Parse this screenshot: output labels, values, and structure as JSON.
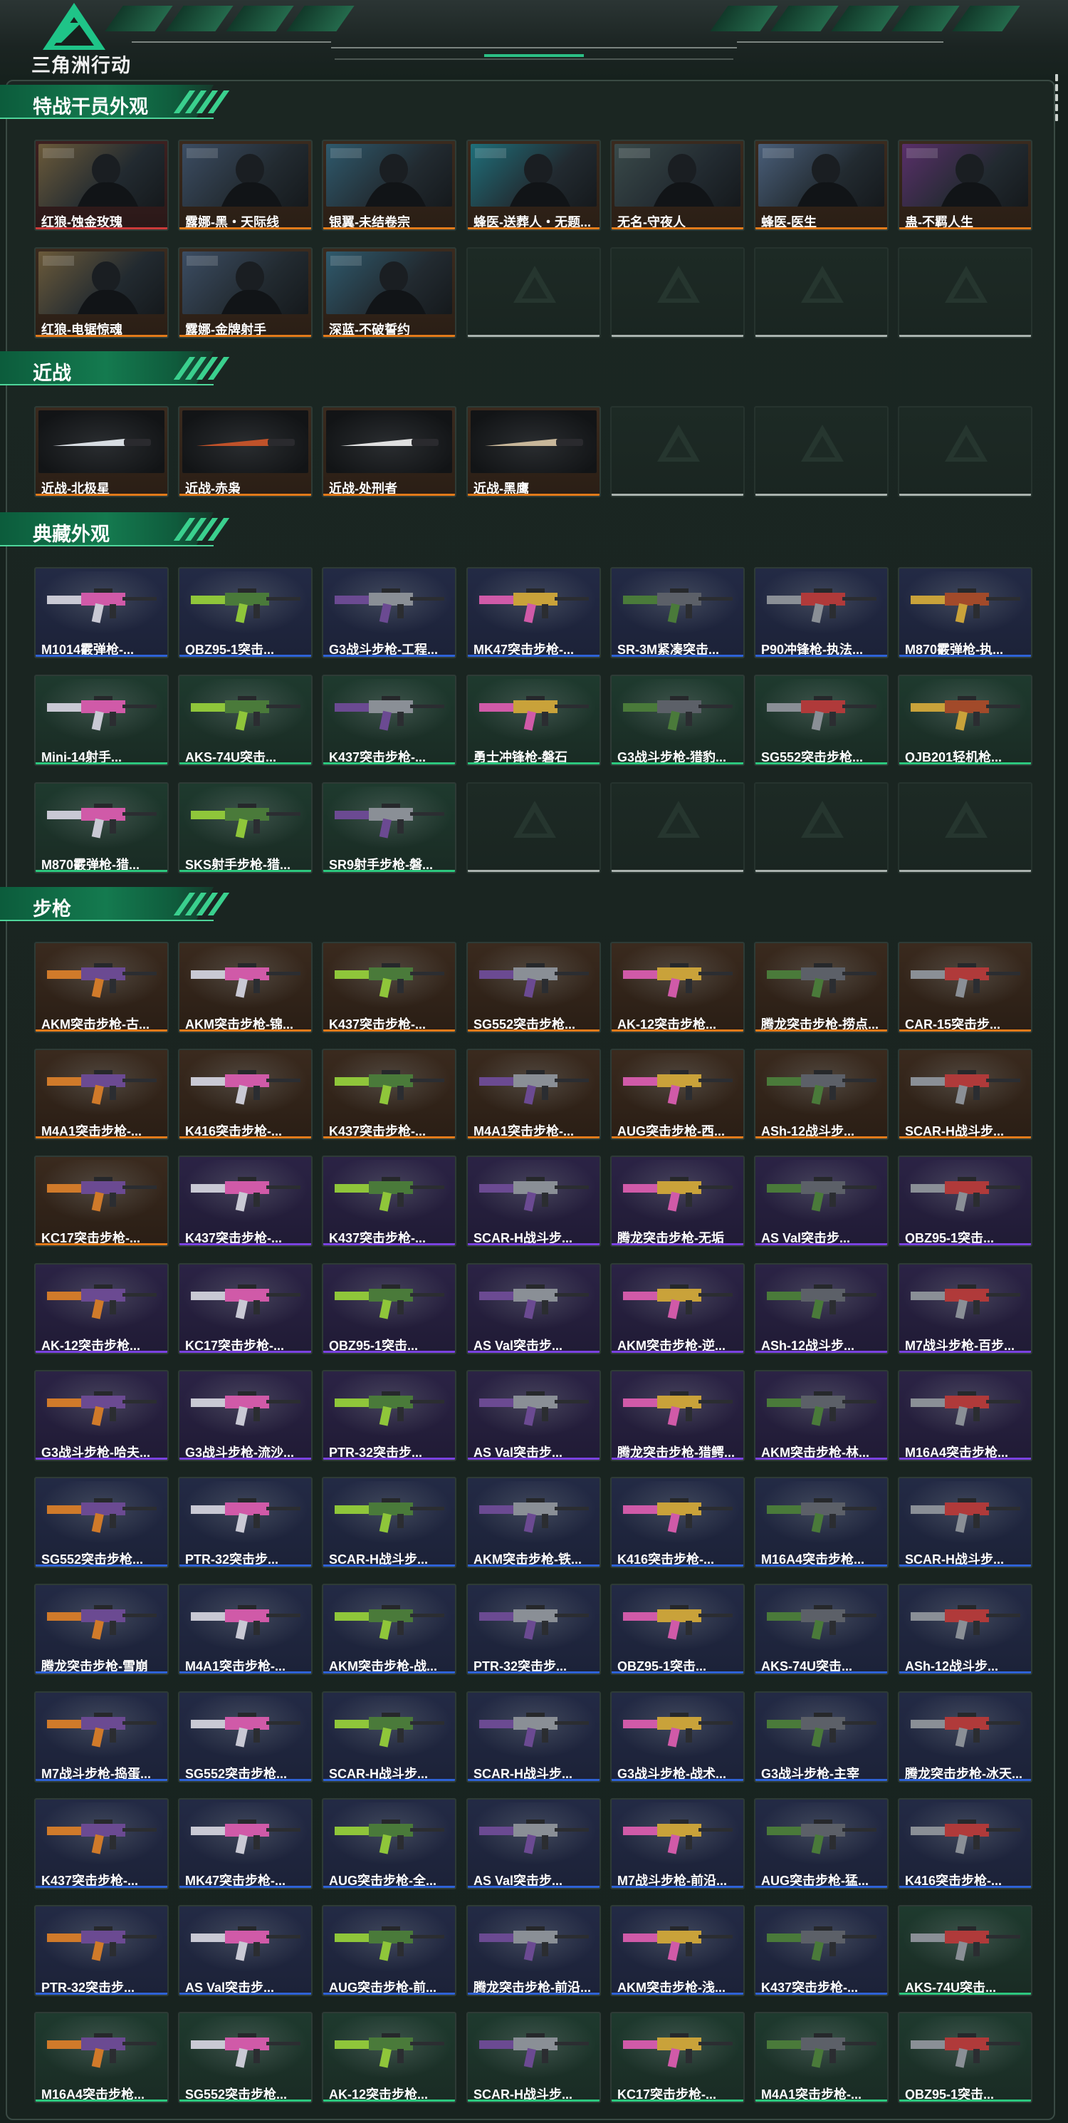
{
  "brand": {
    "logo_text": "三角洲行动"
  },
  "colors": {
    "orange": "#e27a1a",
    "blue": "#2e62d6",
    "green": "#2cc77e",
    "purple": "#7a42e0",
    "red": "#cc3a3a"
  },
  "sections": [
    {
      "title": "特战干员外观",
      "kind": "agent",
      "rows": [
        [
          {
            "label": "红狼-蚀金玫瑰",
            "rarity": "red"
          },
          {
            "label": "露娜-黑・天际线",
            "rarity": "orange"
          },
          {
            "label": "银翼-未结卷宗",
            "rarity": "orange"
          },
          {
            "label": "蜂医-送葬人・无题...",
            "rarity": "orange"
          },
          {
            "label": "无名-守夜人",
            "rarity": "orange"
          },
          {
            "label": "蜂医-医生",
            "rarity": "orange"
          },
          {
            "label": "蛊-不羁人生",
            "rarity": "orange"
          }
        ],
        [
          {
            "label": "红狼-电锯惊魂",
            "rarity": "orange"
          },
          {
            "label": "露娜-金牌射手",
            "rarity": "orange"
          },
          {
            "label": "深蓝-不破誓约",
            "rarity": "orange"
          },
          {
            "label": "",
            "rarity": "empty"
          },
          {
            "label": "",
            "rarity": "empty"
          },
          {
            "label": "",
            "rarity": "empty"
          },
          {
            "label": "",
            "rarity": "empty"
          }
        ]
      ]
    },
    {
      "title": "近战",
      "kind": "knife",
      "rows": [
        [
          {
            "label": "近战-北极星",
            "rarity": "orange"
          },
          {
            "label": "近战-赤枭",
            "rarity": "orange"
          },
          {
            "label": "近战-处刑者",
            "rarity": "orange"
          },
          {
            "label": "近战-黑鹰",
            "rarity": "orange"
          },
          {
            "label": "",
            "rarity": "empty"
          },
          {
            "label": "",
            "rarity": "empty"
          },
          {
            "label": "",
            "rarity": "empty"
          }
        ]
      ]
    },
    {
      "title": "典藏外观",
      "kind": "gun",
      "rows": [
        [
          {
            "label": "M1014霰弹枪-...",
            "rarity": "blue"
          },
          {
            "label": "QBZ95-1突击...",
            "rarity": "blue"
          },
          {
            "label": "G3战斗步枪-工程...",
            "rarity": "blue"
          },
          {
            "label": "MK47突击步枪-...",
            "rarity": "blue"
          },
          {
            "label": "SR-3M紧凑突击...",
            "rarity": "blue"
          },
          {
            "label": "P90冲锋枪-执法...",
            "rarity": "blue"
          },
          {
            "label": "M870霰弹枪-执...",
            "rarity": "blue"
          }
        ],
        [
          {
            "label": "Mini-14射手...",
            "rarity": "green"
          },
          {
            "label": "AKS-74U突击...",
            "rarity": "green"
          },
          {
            "label": "K437突击步枪-...",
            "rarity": "green"
          },
          {
            "label": "勇士冲锋枪-磐石",
            "rarity": "green"
          },
          {
            "label": "G3战斗步枪-猎豹...",
            "rarity": "green"
          },
          {
            "label": "SG552突击步枪...",
            "rarity": "green"
          },
          {
            "label": "QJB201轻机枪...",
            "rarity": "green"
          }
        ],
        [
          {
            "label": "M870霰弹枪-猎...",
            "rarity": "green"
          },
          {
            "label": "SKS射手步枪-猎...",
            "rarity": "green"
          },
          {
            "label": "SR9射手步枪-磐...",
            "rarity": "green"
          },
          {
            "label": "",
            "rarity": "empty"
          },
          {
            "label": "",
            "rarity": "empty"
          },
          {
            "label": "",
            "rarity": "empty"
          },
          {
            "label": "",
            "rarity": "empty"
          }
        ]
      ]
    },
    {
      "title": "步枪",
      "kind": "gun",
      "rows": [
        [
          {
            "label": "AKM突击步枪-古...",
            "rarity": "orange"
          },
          {
            "label": "AKM突击步枪-锦...",
            "rarity": "orange"
          },
          {
            "label": "K437突击步枪-...",
            "rarity": "orange"
          },
          {
            "label": "SG552突击步枪...",
            "rarity": "orange"
          },
          {
            "label": "AK-12突击步枪...",
            "rarity": "orange"
          },
          {
            "label": "腾龙突击步枪-捞点...",
            "rarity": "orange"
          },
          {
            "label": "CAR-15突击步...",
            "rarity": "orange"
          }
        ],
        [
          {
            "label": "M4A1突击步枪-...",
            "rarity": "orange"
          },
          {
            "label": "K416突击步枪-...",
            "rarity": "orange"
          },
          {
            "label": "K437突击步枪-...",
            "rarity": "orange"
          },
          {
            "label": "M4A1突击步枪-...",
            "rarity": "orange"
          },
          {
            "label": "AUG突击步枪-西...",
            "rarity": "orange"
          },
          {
            "label": "ASh-12战斗步...",
            "rarity": "orange"
          },
          {
            "label": "SCAR-H战斗步...",
            "rarity": "orange"
          }
        ],
        [
          {
            "label": "KC17突击步枪-...",
            "rarity": "orange"
          },
          {
            "label": "K437突击步枪-...",
            "rarity": "purple"
          },
          {
            "label": "K437突击步枪-...",
            "rarity": "purple"
          },
          {
            "label": "SCAR-H战斗步...",
            "rarity": "purple"
          },
          {
            "label": "腾龙突击步枪-无垢",
            "rarity": "purple"
          },
          {
            "label": "AS Val突击步...",
            "rarity": "purple"
          },
          {
            "label": "QBZ95-1突击...",
            "rarity": "purple"
          }
        ],
        [
          {
            "label": "AK-12突击步枪...",
            "rarity": "purple"
          },
          {
            "label": "KC17突击步枪-...",
            "rarity": "purple"
          },
          {
            "label": "QBZ95-1突击...",
            "rarity": "purple"
          },
          {
            "label": "AS Val突击步...",
            "rarity": "purple"
          },
          {
            "label": "AKM突击步枪-逆...",
            "rarity": "purple"
          },
          {
            "label": "ASh-12战斗步...",
            "rarity": "purple"
          },
          {
            "label": "M7战斗步枪-百步...",
            "rarity": "purple"
          }
        ],
        [
          {
            "label": "G3战斗步枪-哈夫...",
            "rarity": "purple"
          },
          {
            "label": "G3战斗步枪-流沙...",
            "rarity": "purple"
          },
          {
            "label": "PTR-32突击步...",
            "rarity": "purple"
          },
          {
            "label": "AS Val突击步...",
            "rarity": "purple"
          },
          {
            "label": "腾龙突击步枪-猎鳄...",
            "rarity": "purple"
          },
          {
            "label": "AKM突击步枪-林...",
            "rarity": "purple"
          },
          {
            "label": "M16A4突击步枪...",
            "rarity": "purple"
          }
        ],
        [
          {
            "label": "SG552突击步枪...",
            "rarity": "blue"
          },
          {
            "label": "PTR-32突击步...",
            "rarity": "blue"
          },
          {
            "label": "SCAR-H战斗步...",
            "rarity": "blue"
          },
          {
            "label": "AKM突击步枪-铁...",
            "rarity": "blue"
          },
          {
            "label": "K416突击步枪-...",
            "rarity": "blue"
          },
          {
            "label": "M16A4突击步枪...",
            "rarity": "blue"
          },
          {
            "label": "SCAR-H战斗步...",
            "rarity": "blue"
          }
        ],
        [
          {
            "label": "腾龙突击步枪-雪崩",
            "rarity": "blue"
          },
          {
            "label": "M4A1突击步枪-...",
            "rarity": "blue"
          },
          {
            "label": "AKM突击步枪-战...",
            "rarity": "blue"
          },
          {
            "label": "PTR-32突击步...",
            "rarity": "blue"
          },
          {
            "label": "QBZ95-1突击...",
            "rarity": "blue"
          },
          {
            "label": "AKS-74U突击...",
            "rarity": "blue"
          },
          {
            "label": "ASh-12战斗步...",
            "rarity": "blue"
          }
        ],
        [
          {
            "label": "M7战斗步枪-捣蛋...",
            "rarity": "blue"
          },
          {
            "label": "SG552突击步枪...",
            "rarity": "blue"
          },
          {
            "label": "SCAR-H战斗步...",
            "rarity": "blue"
          },
          {
            "label": "SCAR-H战斗步...",
            "rarity": "blue"
          },
          {
            "label": "G3战斗步枪-战术...",
            "rarity": "blue"
          },
          {
            "label": "G3战斗步枪-主宰",
            "rarity": "blue"
          },
          {
            "label": "腾龙突击步枪-冰天...",
            "rarity": "blue"
          }
        ],
        [
          {
            "label": "K437突击步枪-...",
            "rarity": "blue"
          },
          {
            "label": "MK47突击步枪-...",
            "rarity": "blue"
          },
          {
            "label": "AUG突击步枪-全...",
            "rarity": "blue"
          },
          {
            "label": "AS Val突击步...",
            "rarity": "blue"
          },
          {
            "label": "M7战斗步枪-前沿...",
            "rarity": "blue"
          },
          {
            "label": "AUG突击步枪-猛...",
            "rarity": "blue"
          },
          {
            "label": "K416突击步枪-...",
            "rarity": "blue"
          }
        ],
        [
          {
            "label": "PTR-32突击步...",
            "rarity": "blue"
          },
          {
            "label": "AS Val突击步...",
            "rarity": "blue"
          },
          {
            "label": "AUG突击步枪-前...",
            "rarity": "blue"
          },
          {
            "label": "腾龙突击步枪-前沿...",
            "rarity": "blue"
          },
          {
            "label": "AKM突击步枪-浅...",
            "rarity": "blue"
          },
          {
            "label": "K437突击步枪-...",
            "rarity": "blue"
          },
          {
            "label": "AKS-74U突击...",
            "rarity": "green"
          }
        ],
        [
          {
            "label": "M16A4突击步枪...",
            "rarity": "green"
          },
          {
            "label": "SG552突击步枪...",
            "rarity": "green"
          },
          {
            "label": "AK-12突击步枪...",
            "rarity": "green"
          },
          {
            "label": "SCAR-H战斗步...",
            "rarity": "green"
          },
          {
            "label": "KC17突击步枪-...",
            "rarity": "green"
          },
          {
            "label": "M4A1突击步枪-...",
            "rarity": "green"
          },
          {
            "label": "QBZ95-1突击...",
            "rarity": "green"
          }
        ]
      ]
    }
  ]
}
